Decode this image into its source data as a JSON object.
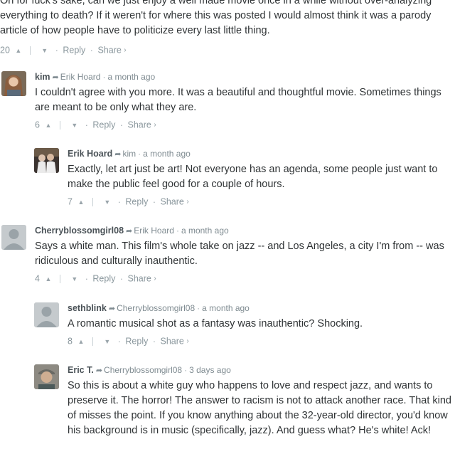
{
  "top_comment": {
    "text": "Oh for fuck's sake, can we just enjoy a well made movie once in a while without over-analyzing everything to death? If it weren't for where this was posted I would almost think it was a parody article of how people have to politicize every last little thing.",
    "votes": "20"
  },
  "actions": {
    "reply": "Reply",
    "share": "Share",
    "share_chevron": "›"
  },
  "comments": [
    {
      "author": "kim",
      "reply_to": "Erik Hoard",
      "time": "a month ago",
      "text": "I couldn't agree with you more. It was a beautiful and thoughtful movie. Sometimes things are meant to be only what they are.",
      "votes": "6"
    },
    {
      "author": "Erik Hoard",
      "reply_to": "kim",
      "time": "a month ago",
      "text": "Exactly, let art just be art! Not everyone has an agenda, some people just want to make the public feel good for a couple of hours.",
      "votes": "7"
    },
    {
      "author": "Cherryblossomgirl08",
      "reply_to": "Erik Hoard",
      "time": "a month ago",
      "text": "Says a white man. This film's whole take on jazz -- and Los Angeles, a city I'm from -- was ridiculous and culturally inauthentic.",
      "votes": "4"
    },
    {
      "author": "sethblink",
      "reply_to": "Cherryblossomgirl08",
      "time": "a month ago",
      "text": "A romantic musical shot as a fantasy was inauthentic? Shocking.",
      "votes": "8"
    },
    {
      "author": "Eric T.",
      "reply_to": "Cherryblossomgirl08",
      "time": "3 days ago",
      "text": "So this is about a white guy who happens to love and respect jazz, and wants to preserve it. The horror! The answer to racism is not to attack another race. That kind of misses the point. If you know anything about the 32-year-old director, you'd know his background is in music (specifically, jazz). And guess what? He's white! Ack!"
    }
  ]
}
